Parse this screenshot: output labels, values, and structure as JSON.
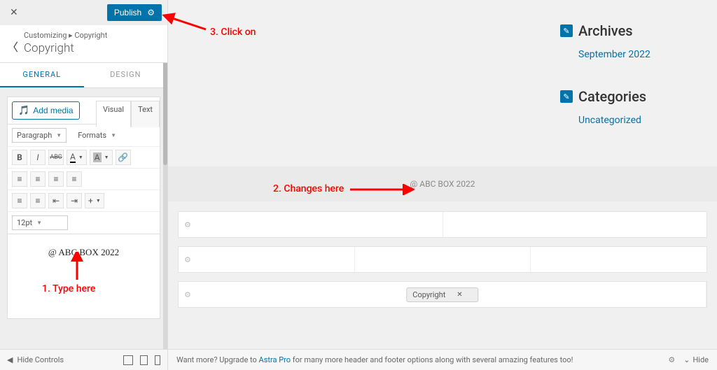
{
  "sidebar": {
    "close_label": "✕",
    "publish_label": "Publish",
    "crumb": "Customizing ▸ Copyright",
    "panel_title": "Copyright",
    "tabs": {
      "general": "GENERAL",
      "design": "DESIGN"
    },
    "add_media": "Add media",
    "mini_tabs": {
      "visual": "Visual",
      "text": "Text"
    },
    "paragraph_sel": "Paragraph",
    "formats_sel": "Formats",
    "fontsize_sel": "12pt",
    "editor_content": "@ ABC BOX 2022",
    "toolbar": {
      "bold": "B",
      "italic": "I",
      "strike": "ABC",
      "text_color": "A",
      "bg_color": "A",
      "link": "🔗",
      "align_left": "≡",
      "align_center": "≡",
      "align_right": "≡",
      "justify": "≡",
      "ul": "≡",
      "ol": "≡",
      "outdent": "⇤",
      "indent": "⇥",
      "more": "+"
    }
  },
  "preview": {
    "widgets": {
      "archives_title": "Archives",
      "archives_link": "September 2022",
      "categories_title": "Categories",
      "categories_link": "Uncategorized"
    },
    "footer_text": "@ ABC BOX 2022",
    "chip_label": "Copyright",
    "chip_close": "✕"
  },
  "bottombar": {
    "hide_controls": "Hide Controls",
    "message_pre": "Want more? Upgrade to ",
    "message_link": "Astra Pro",
    "message_post": " for many more header and footer options along with several amazing features too!",
    "hide_label": "Hide"
  },
  "annotations": {
    "a1": "1. Type here",
    "a2": "2. Changes here",
    "a3": "3. Click on"
  }
}
